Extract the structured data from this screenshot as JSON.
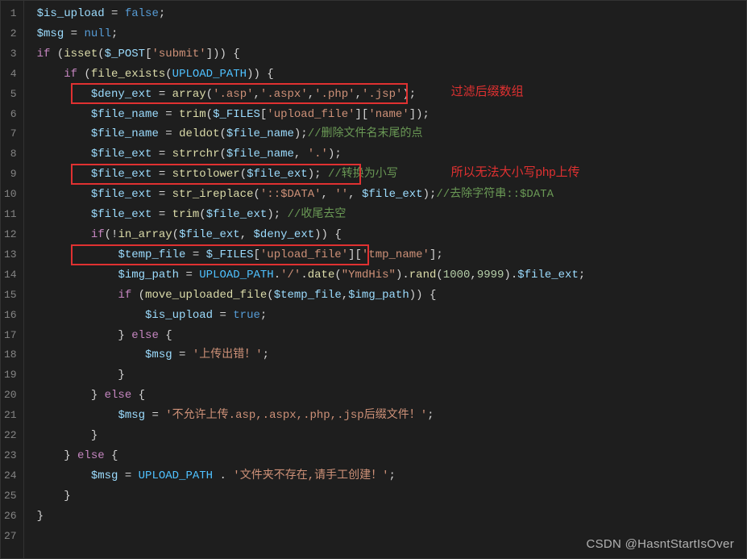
{
  "line_numbers": [
    "1",
    "2",
    "3",
    "4",
    "5",
    "6",
    "7",
    "8",
    "9",
    "10",
    "11",
    "12",
    "13",
    "14",
    "15",
    "16",
    "17",
    "18",
    "19",
    "20",
    "21",
    "22",
    "23",
    "24",
    "25",
    "26",
    "27"
  ],
  "code": {
    "l1": {
      "a": "$is_upload",
      "b": " = ",
      "c": "false",
      "d": ";"
    },
    "l2": {
      "a": "$msg",
      "b": " = ",
      "c": "null",
      "d": ";"
    },
    "l3": {
      "a": "if",
      "b": " (",
      "c": "isset",
      "d": "(",
      "e": "$_POST",
      "f": "[",
      "g": "'submit'",
      "h": "])) {"
    },
    "l4": {
      "a": "    ",
      "b": "if",
      "c": " (",
      "d": "file_exists",
      "e": "(",
      "f": "UPLOAD_PATH",
      "g": ")) {"
    },
    "l5": {
      "a": "        ",
      "b": "$deny_ext",
      "c": " = ",
      "d": "array",
      "e": "(",
      "f": "'.asp'",
      "g": ",",
      "h": "'.aspx'",
      "i": ",",
      "j": "'.php'",
      "k": ",",
      "l": "'.jsp'",
      "m": ");"
    },
    "l6": {
      "a": "        ",
      "b": "$file_name",
      "c": " = ",
      "d": "trim",
      "e": "(",
      "f": "$_FILES",
      "g": "[",
      "h": "'upload_file'",
      "i": "][",
      "j": "'name'",
      "k": "]);"
    },
    "l7": {
      "a": "        ",
      "b": "$file_name",
      "c": " = ",
      "d": "deldot",
      "e": "(",
      "f": "$file_name",
      "g": ");",
      "h": "//删除文件名末尾的点"
    },
    "l8": {
      "a": "        ",
      "b": "$file_ext",
      "c": " = ",
      "d": "strrchr",
      "e": "(",
      "f": "$file_name",
      "g": ", ",
      "h": "'.'",
      "i": ");"
    },
    "l9": {
      "a": "        ",
      "b": "$file_ext",
      "c": " = ",
      "d": "strtolower",
      "e": "(",
      "f": "$file_ext",
      "g": "); ",
      "h": "//转换为小写"
    },
    "l10": {
      "a": "        ",
      "b": "$file_ext",
      "c": " = ",
      "d": "str_ireplace",
      "e": "(",
      "f": "'::$DATA'",
      "g": ", ",
      "h": "''",
      "i": ", ",
      "j": "$file_ext",
      "k": ");",
      "l": "//去除字符串::$DATA"
    },
    "l11": {
      "a": "        ",
      "b": "$file_ext",
      "c": " = ",
      "d": "trim",
      "e": "(",
      "f": "$file_ext",
      "g": "); ",
      "h": "//收尾去空"
    },
    "l12": {
      "a": ""
    },
    "l13": {
      "a": "        ",
      "b": "if",
      "c": "(!",
      "d": "in_array",
      "e": "(",
      "f": "$file_ext",
      "g": ", ",
      "h": "$deny_ext",
      "i": ")) {"
    },
    "l14": {
      "a": "            ",
      "b": "$temp_file",
      "c": " = ",
      "d": "$_FILES",
      "e": "[",
      "f": "'upload_file'",
      "g": "][",
      "h": "'tmp_name'",
      "i": "];"
    },
    "l15": {
      "a": "            ",
      "b": "$img_path",
      "c": " = ",
      "d": "UPLOAD_PATH",
      "e": ".",
      "f": "'/'",
      "g": ".",
      "h": "date",
      "i": "(",
      "j": "\"YmdHis\"",
      "k": ").",
      "l": "rand",
      "m": "(",
      "n": "1000",
      "o": ",",
      "p": "9999",
      "q": ").",
      "r": "$file_ext",
      "s": ";"
    },
    "l16": {
      "a": "            ",
      "b": "if",
      "c": " (",
      "d": "move_uploaded_file",
      "e": "(",
      "f": "$temp_file",
      "g": ",",
      "h": "$img_path",
      "i": ")) {"
    },
    "l17": {
      "a": "                ",
      "b": "$is_upload",
      "c": " = ",
      "d": "true",
      "e": ";"
    },
    "l18": {
      "a": "            } ",
      "b": "else",
      "c": " {"
    },
    "l19": {
      "a": "                ",
      "b": "$msg",
      "c": " = ",
      "d": "'上传出错！'",
      "e": ";"
    },
    "l20": {
      "a": "            }"
    },
    "l21": {
      "a": "        } ",
      "b": "else",
      "c": " {"
    },
    "l22": {
      "a": "            ",
      "b": "$msg",
      "c": " = ",
      "d": "'不允许上传.asp,.aspx,.php,.jsp后缀文件！'",
      "e": ";"
    },
    "l23": {
      "a": "        }"
    },
    "l24": {
      "a": "    } ",
      "b": "else",
      "c": " {"
    },
    "l25": {
      "a": "        ",
      "b": "$msg",
      "c": " = ",
      "d": "UPLOAD_PATH",
      "e": " . ",
      "f": "'文件夹不存在,请手工创建！'",
      "g": ";"
    },
    "l26": {
      "a": "    }"
    },
    "l27": {
      "a": "}"
    }
  },
  "annotations": {
    "a1": "过滤后缀数组",
    "a2": "所以无法大小写php上传"
  },
  "watermark": "CSDN @HasntStartIsOver"
}
